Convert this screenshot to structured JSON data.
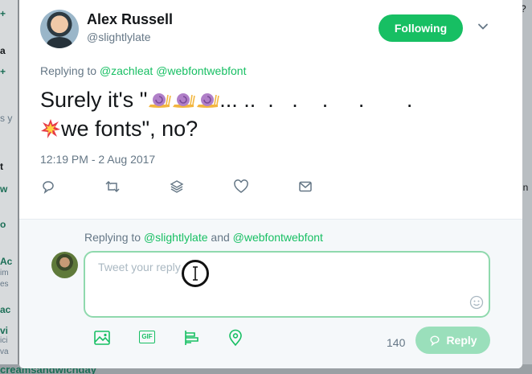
{
  "background": {
    "left_fragments": [
      "+",
      "a",
      "+",
      "s y",
      "t",
      "w",
      "o",
      "Ac",
      "im",
      "es",
      "ac",
      "vi",
      "ici",
      "va"
    ],
    "right_fragments": [
      "?",
      "in"
    ],
    "bottom_text": "creamsandwichday"
  },
  "tweet": {
    "author_name": "Alex Russell",
    "author_handle": "@slightlylate",
    "follow_label": "Following",
    "replying_prefix": "Replying to",
    "replying_users": [
      "@zachleat",
      "@webfontwebfont"
    ],
    "text_line1_start": "Surely it's \"",
    "text_line1_dots": "... ..  .   .    .     .       .",
    "text_line2": "we fonts\", no?",
    "timestamp": "12:19 PM - 2 Aug 2017"
  },
  "reply": {
    "replying_prefix": "Replying to",
    "replying_user1": "@slightlylate",
    "replying_and": "and",
    "replying_user2": "@webfontwebfont",
    "placeholder": "Tweet your reply",
    "char_count": "140",
    "reply_button_label": "Reply"
  },
  "colors": {
    "accent": "#17bf63",
    "accent_disabled": "#9adfbb",
    "muted": "#657786"
  },
  "icons": [
    "chevron-down-icon",
    "reply-icon",
    "retweet-icon",
    "stack-icon",
    "heart-icon",
    "dm-icon",
    "emoji-icon",
    "image-icon",
    "gif-icon",
    "poll-icon",
    "location-icon",
    "snail-icon",
    "collision-icon"
  ]
}
